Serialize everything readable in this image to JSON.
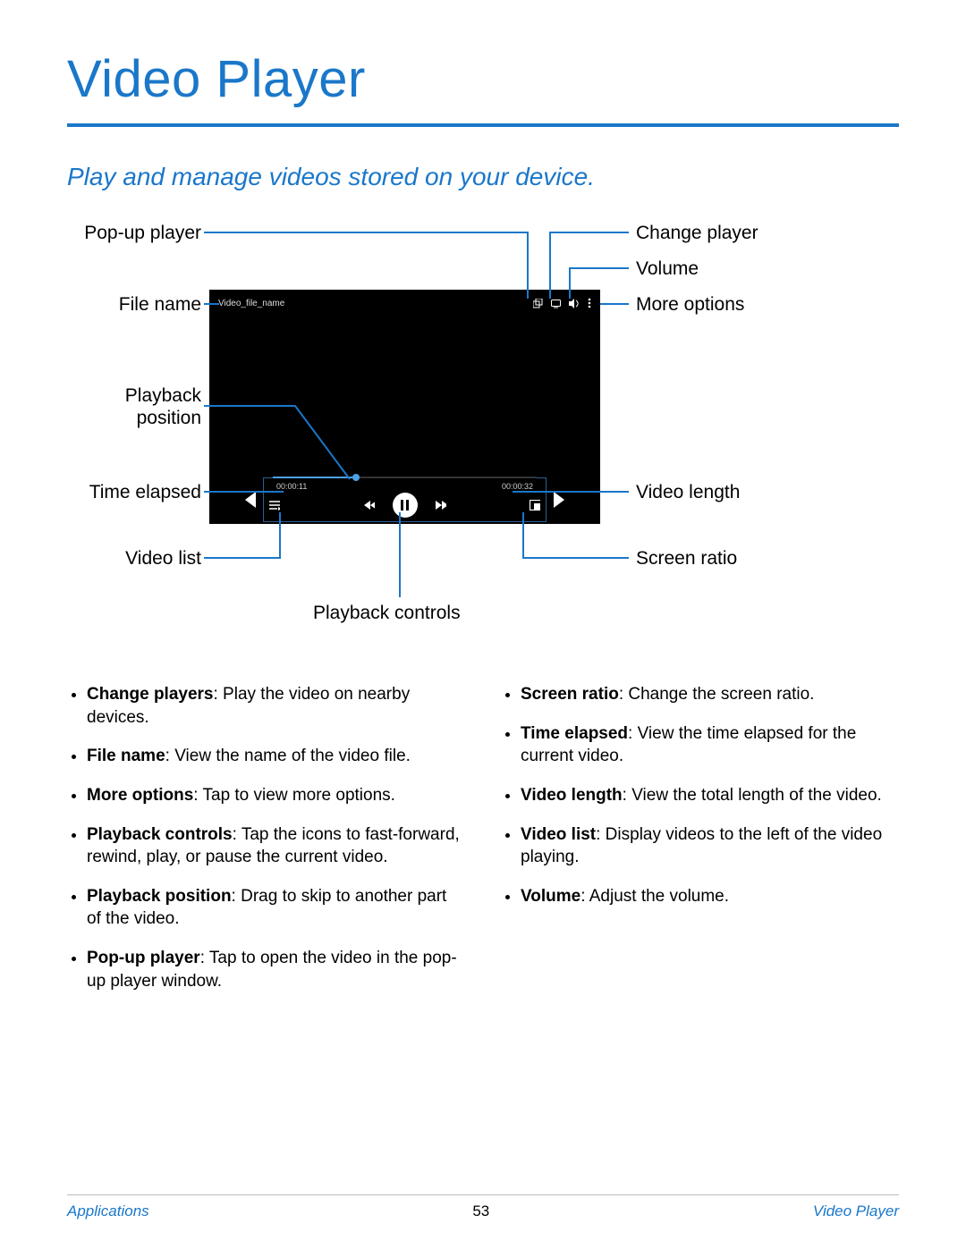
{
  "title": "Video Player",
  "subtitle": "Play and manage videos stored on your device.",
  "labels": {
    "popup": "Pop-up player",
    "filename_lbl": "File name",
    "playback_pos_l1": "Playback",
    "playback_pos_l2": "position",
    "time_elapsed": "Time elapsed",
    "video_list": "Video list",
    "playback_controls": "Playback controls",
    "change_player": "Change player",
    "volume": "Volume",
    "more_options": "More options",
    "video_length": "Video length",
    "screen_ratio": "Screen ratio"
  },
  "player": {
    "file_name": "Video_file_name",
    "elapsed": "00:00:11",
    "length": "00:00:32"
  },
  "bullets_left": [
    {
      "b": "Change players",
      "t": ": Play the video on nearby devices."
    },
    {
      "b": "File name",
      "t": ": View the name of the video file."
    },
    {
      "b": "More options",
      "t": ": Tap to view more options."
    },
    {
      "b": "Playback controls",
      "t": ": Tap the icons to fast-forward, rewind, play, or pause the current video."
    },
    {
      "b": "Playback position",
      "t": ": Drag to skip to another part of the video."
    },
    {
      "b": "Pop-up player",
      "t": ": Tap to open the video in the pop-up player window."
    }
  ],
  "bullets_right": [
    {
      "b": "Screen ratio",
      "t": ": Change the screen ratio."
    },
    {
      "b": "Time elapsed",
      "t": ": View the time elapsed for the current video."
    },
    {
      "b": "Video length",
      "t": ": View the total length of the video."
    },
    {
      "b": "Video list",
      "t": ": Display videos to the left of the video playing."
    },
    {
      "b": "Volume",
      "t": ": Adjust the volume."
    }
  ],
  "footer": {
    "left": "Applications",
    "page": "53",
    "right": "Video Player"
  }
}
